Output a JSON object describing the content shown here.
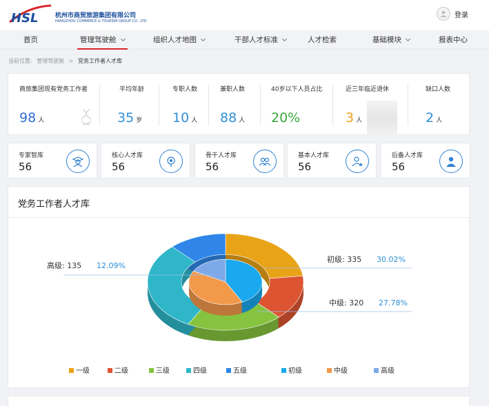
{
  "header": {
    "logo_text": "HSL",
    "company_cn": "杭州市商贸旅游集团有限公司",
    "company_en": "HANGZHOU COMMERCE & TOURISM GROUP CO., LTD",
    "login_label": "登录"
  },
  "nav": {
    "items": [
      {
        "label": "首页",
        "dropdown": false,
        "active": false
      },
      {
        "label": "管理驾驶舱",
        "dropdown": true,
        "active": true
      },
      {
        "label": "组织人才地图",
        "dropdown": true,
        "active": false
      },
      {
        "label": "干部人才标准",
        "dropdown": true,
        "active": false
      },
      {
        "label": "人才检索",
        "dropdown": false,
        "active": false
      },
      {
        "label": "基础模块",
        "dropdown": true,
        "active": false
      },
      {
        "label": "报表中心",
        "dropdown": false,
        "active": false
      }
    ]
  },
  "breadcrumb": {
    "prefix": "当前位置:",
    "parent": "管理驾驶舱",
    "separator": ">",
    "current": "党务工作者人才库"
  },
  "stats": [
    {
      "label": "商旅集团现有党务工作者",
      "value": "98",
      "unit": "人",
      "color": "#2f6fd6"
    },
    {
      "label": "平均年龄",
      "value": "35",
      "unit": "岁",
      "color": "#2f8fd6"
    },
    {
      "label": "专职人数",
      "value": "10",
      "unit": "人",
      "color": "#2f8fd6"
    },
    {
      "label": "兼职人数",
      "value": "88",
      "unit": "人",
      "color": "#2f8fd6"
    },
    {
      "label": "40岁以下人员占比",
      "value": "20%",
      "unit": "",
      "color": "#3aa63a"
    },
    {
      "label": "近三年临近退休",
      "value": "3",
      "unit": "人",
      "color": "#f0a21a"
    },
    {
      "label": "缺口人数",
      "value": "2",
      "unit": "人",
      "color": "#2f8fd6"
    }
  ],
  "libraries": [
    {
      "label": "专家智库",
      "value": "56",
      "icon": "expert-icon"
    },
    {
      "label": "核心人才库",
      "value": "56",
      "icon": "core-talent-icon"
    },
    {
      "label": "骨干人才库",
      "value": "56",
      "icon": "backbone-talent-icon"
    },
    {
      "label": "基本人才库",
      "value": "56",
      "icon": "basic-talent-icon"
    },
    {
      "label": "后备人才库",
      "value": "56",
      "icon": "reserve-talent-icon"
    }
  ],
  "panel": {
    "title": "党务工作者人才库"
  },
  "chart_data": {
    "type": "pie",
    "rings": [
      {
        "name": "outer",
        "slices": [
          {
            "name": "一级",
            "value": 23,
            "color": "#e8a317"
          },
          {
            "name": "二级",
            "value": 15,
            "color": "#dd5432"
          },
          {
            "name": "三级",
            "value": 20,
            "color": "#86c33f"
          },
          {
            "name": "四级",
            "value": 30,
            "color": "#2fb6c9"
          },
          {
            "name": "五级",
            "value": 12,
            "color": "#2f86e8"
          }
        ]
      },
      {
        "name": "inner",
        "slices": [
          {
            "name": "初级",
            "value": 335,
            "percent": "30.02%",
            "color": "#1aa8ee"
          },
          {
            "name": "中级",
            "value": 320,
            "percent": "27.78%",
            "color": "#f2994a"
          },
          {
            "name": "高级",
            "value": 135,
            "percent": "12.09%",
            "color": "#7ea9e8"
          }
        ]
      }
    ],
    "labels": [
      {
        "name": "高级",
        "value": "135",
        "percent": "12.09%"
      },
      {
        "name": "初级",
        "value": "335",
        "percent": "30.02%"
      },
      {
        "name": "中级",
        "value": "320",
        "percent": "27.78%"
      }
    ],
    "legend": [
      {
        "name": "一级",
        "color": "#e8a317"
      },
      {
        "name": "二级",
        "color": "#dd5432"
      },
      {
        "name": "三级",
        "color": "#86c33f"
      },
      {
        "name": "四级",
        "color": "#2fb6c9"
      },
      {
        "name": "五级",
        "color": "#2f86e8"
      },
      {
        "name": "初级",
        "color": "#1aa8ee"
      },
      {
        "name": "中级",
        "color": "#f2994a"
      },
      {
        "name": "高级",
        "color": "#7ea9e8"
      }
    ],
    "legend_position": "bottom",
    "percent_color": "#2f8fd6",
    "label_separator": ":"
  }
}
